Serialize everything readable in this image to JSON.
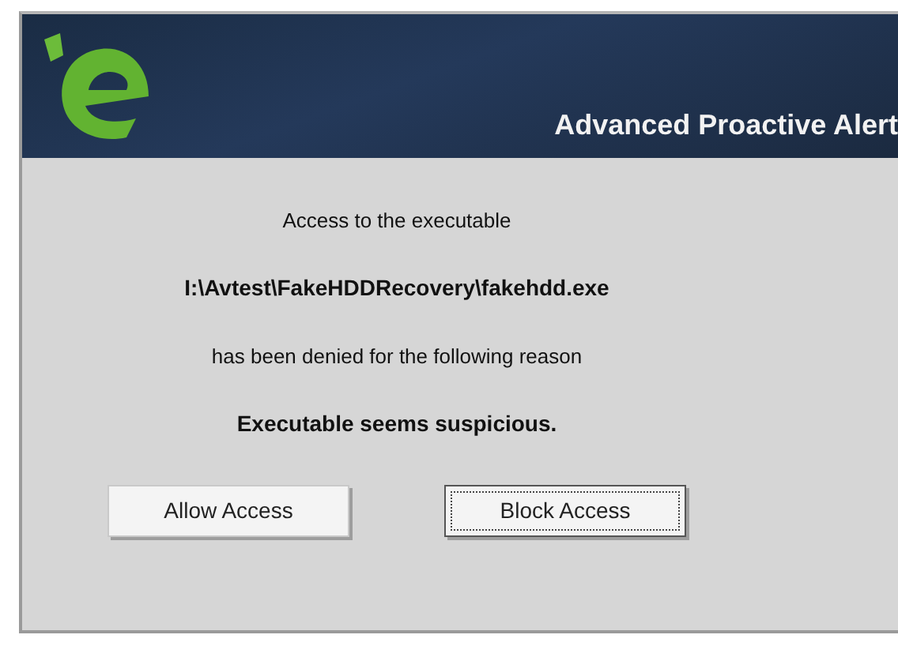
{
  "header": {
    "title": "Advanced Proactive Alert"
  },
  "message": [
    {
      "text": "Access to the executable",
      "kind": "plain"
    },
    {
      "text": "I:\\Avtest\\FakeHDDRecovery\\fakehdd.exe",
      "kind": "strong"
    },
    {
      "text": "has been denied for the following reason",
      "kind": "plain"
    },
    {
      "text": "Executable seems suspicious.",
      "kind": "strong"
    }
  ],
  "buttons": [
    {
      "label": "Allow Access",
      "focused": false
    },
    {
      "label": "Block Access",
      "focused": true
    }
  ]
}
